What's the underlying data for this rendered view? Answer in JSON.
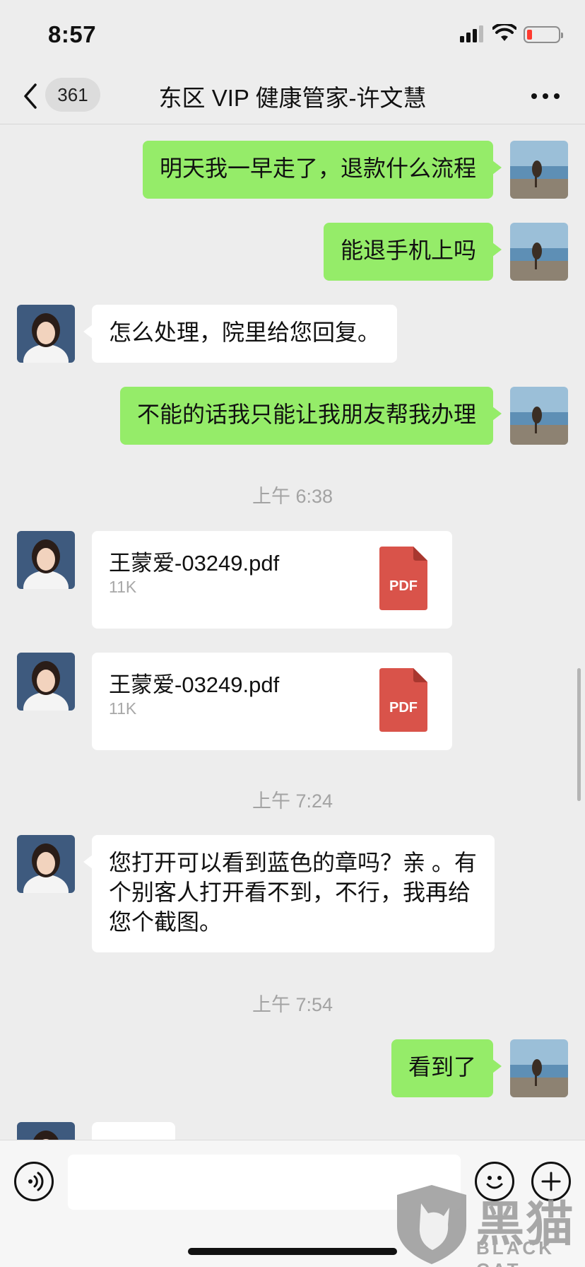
{
  "status_bar": {
    "time": "8:57"
  },
  "nav": {
    "unread_count": "361",
    "title": "东区 VIP 健康管家-许文慧"
  },
  "messages": [
    {
      "side": "me",
      "text": "明天我一早走了，退款什么流程"
    },
    {
      "side": "me",
      "text": "能退手机上吗"
    },
    {
      "side": "other",
      "text": "怎么处理，院里给您回复。"
    },
    {
      "side": "me",
      "text": "不能的话我只能让我朋友帮我办理"
    },
    {
      "timestamp": "上午 6:38"
    },
    {
      "side": "other",
      "file": {
        "name": "王蒙爱-03249.pdf",
        "size": "11K",
        "icon_label": "PDF"
      }
    },
    {
      "side": "other",
      "file": {
        "name": "王蒙爱-03249.pdf",
        "size": "11K",
        "icon_label": "PDF"
      }
    },
    {
      "timestamp": "上午 7:24"
    },
    {
      "side": "other",
      "text": "您打开可以看到蓝色的章吗？亲 。有个别客人打开看不到，不行，我再给您个截图。"
    },
    {
      "timestamp": "上午 7:54"
    },
    {
      "side": "me",
      "text": "看到了"
    }
  ],
  "input_bar": {
    "text": ""
  },
  "watermark": {
    "cn": "黑猫",
    "en": "BLACK CAT"
  },
  "colors": {
    "sent_bubble": "#95ec69",
    "received_bubble": "#ffffff",
    "background": "#ededed",
    "pdf_red": "#d9534a"
  }
}
